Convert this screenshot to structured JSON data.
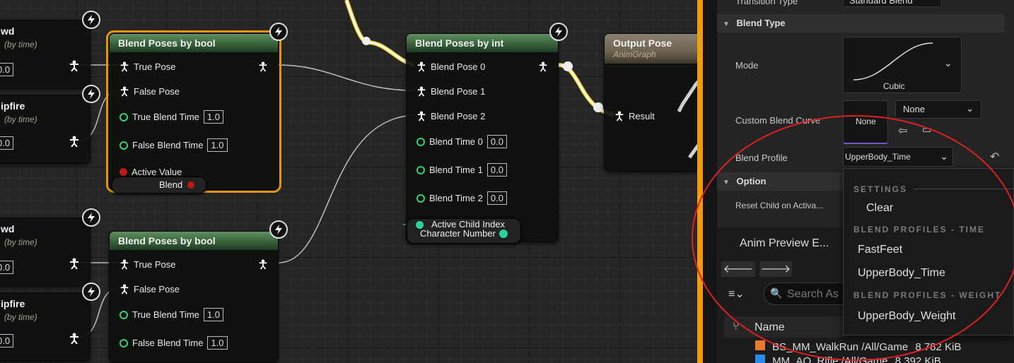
{
  "graph": {
    "left_nodes": [
      {
        "title": "wd",
        "subtitle": "(by time)",
        "value": "0.0"
      },
      {
        "title": "ipfire",
        "subtitle": "(by time)",
        "value": "0.0"
      },
      {
        "title": "wd",
        "subtitle": "(by time)",
        "value": "0.0"
      },
      {
        "title": "ipfire",
        "subtitle": "(by time)",
        "value": "0.0"
      }
    ],
    "bool_node_1": {
      "title": "Blend Poses by bool",
      "true_pose": "True Pose",
      "false_pose": "False Pose",
      "true_blend_time": "True Blend Time",
      "true_blend_value": "1.0",
      "false_blend_time": "False Blend Time",
      "false_blend_value": "1.0",
      "active_value": "Active Value",
      "blend_var": "Blend"
    },
    "bool_node_2": {
      "title": "Blend Poses by bool",
      "true_pose": "True Pose",
      "false_pose": "False Pose",
      "true_blend_time": "True Blend Time",
      "true_blend_value": "1.0",
      "false_blend_time": "False Blend Time",
      "false_blend_value": "1.0"
    },
    "int_node": {
      "title": "Blend Poses by int",
      "pose0": "Blend Pose 0",
      "pose1": "Blend Pose 1",
      "pose2": "Blend Pose 2",
      "time0": "Blend Time 0",
      "time0_value": "0.0",
      "time1": "Blend Time 1",
      "time1_value": "0.0",
      "time2": "Blend Time 2",
      "time2_value": "0.0",
      "active_child": "Active Child Index",
      "char_var": "Character Number"
    },
    "output_node": {
      "title": "Output Pose",
      "subtitle": "AnimGraph",
      "result": "Result"
    }
  },
  "details": {
    "transition_type_label": "Transition Type",
    "transition_type_value": "Standard Blend",
    "blend_type_section": "Blend Type",
    "mode_label": "Mode",
    "mode_value": "Cubic",
    "custom_curve_label": "Custom Blend Curve",
    "custom_curve_thumb": "None",
    "custom_curve_value": "None",
    "blend_profile_label": "Blend Profile",
    "blend_profile_value": "UpperBody_Time",
    "option_section": "Option",
    "reset_child_label": "Reset Child on Activa...",
    "preview_tab": "Anim Preview E...",
    "search_placeholder": "Search As",
    "name_header": "Name",
    "assets": [
      {
        "name": "BS_MM_WalkRun",
        "path": "/All/Game",
        "size": "8.782 KiB"
      },
      {
        "name": "MM_AO_Rifle",
        "path": "/All/Game",
        "size": "8.392 KiB"
      }
    ]
  },
  "menu": {
    "settings_header": "SETTINGS",
    "clear": "Clear",
    "time_header": "BLEND PROFILES - TIME",
    "fastfeet": "FastFeet",
    "upperbody_time": "UpperBody_Time",
    "weight_header": "BLEND PROFILES - WEIGHT",
    "upperbody_weight": "UpperBody_Weight"
  },
  "colors": {
    "accent_orange": "#f29a12",
    "pin_green": "#33d17a",
    "node_header_green": "#3e6a40",
    "annotation_red": "#e02020",
    "var_red": "#c01818",
    "var_teal": "#2ad1a0"
  }
}
